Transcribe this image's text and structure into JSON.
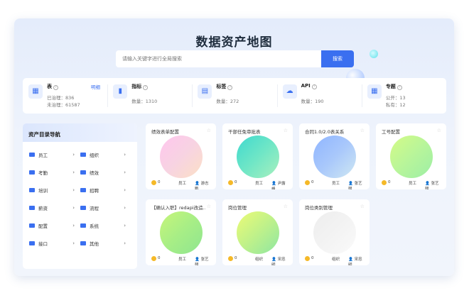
{
  "page": {
    "title": "数据资产地图"
  },
  "search": {
    "placeholder": "请输入关键字进行全局搜索",
    "button": "搜索"
  },
  "stats": [
    {
      "icon": "table-icon",
      "name": "表",
      "link": "明细",
      "lines": [
        "已治理：836",
        "未治理：61587"
      ]
    },
    {
      "icon": "metric-chart-icon",
      "name": "指标",
      "lines": [
        "数量：1310"
      ]
    },
    {
      "icon": "tag-icon",
      "name": "标签",
      "lines": [
        "数量：272"
      ]
    },
    {
      "icon": "cloud-api-icon",
      "name": "API",
      "lines": [
        "数量：190"
      ]
    },
    {
      "icon": "topic-grid-icon",
      "name": "专题",
      "lines": [
        "公开：13",
        "私有：12"
      ]
    }
  ],
  "nav": {
    "title": "资产目录导航",
    "items": [
      "员工",
      "组织",
      "考勤",
      "绩效",
      "培训",
      "招聘",
      "薪资",
      "流程",
      "配置",
      "系统",
      "接口",
      "其他"
    ]
  },
  "cards": [
    {
      "title": "绩效表单配置",
      "count": "0",
      "category": "员工",
      "user": "游志鹏",
      "colors": [
        "#ffc6ee",
        "#f7d3e2",
        "#fce0c5"
      ]
    },
    {
      "title": "干部任免审批表",
      "count": "0",
      "category": "员工",
      "user": "尹露峰",
      "colors": [
        "#3fd9cf",
        "#6fe6c6",
        "#a9f0be"
      ]
    },
    {
      "title": "合同1.0/2.0表关系",
      "count": "0",
      "category": "员工",
      "user": "张艺朝",
      "colors": [
        "#8fb5ff",
        "#a9c8fb",
        "#cfe8f2"
      ]
    },
    {
      "title": "工号配置",
      "count": "0",
      "category": "员工",
      "user": "张艺朝",
      "colors": [
        "#d5fb86",
        "#b8f59a",
        "#9deea6"
      ]
    },
    {
      "title": "【确认入职】redapi改造…",
      "count": "0",
      "category": "员工",
      "user": "张艺朝",
      "colors": [
        "#c7f57a",
        "#a7ee86",
        "#8fe590"
      ]
    },
    {
      "title": "岗位管理",
      "count": "0",
      "category": "组织",
      "user": "宋忠明",
      "colors": [
        "#ecfb76",
        "#bff18a",
        "#8ee6a2"
      ]
    },
    {
      "title": "岗位类别管理",
      "count": "0",
      "category": "组织",
      "user": "宋忠明",
      "colors": [
        "#ededed",
        "#f3f3f3",
        "#fafafa"
      ]
    }
  ]
}
